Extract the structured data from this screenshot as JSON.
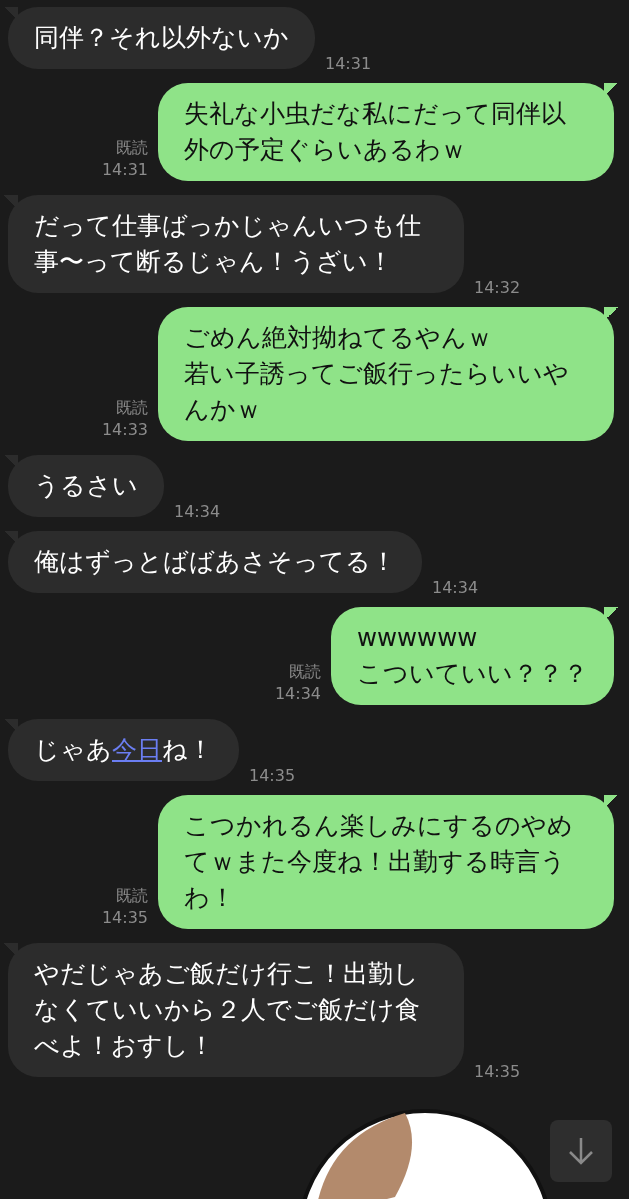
{
  "messages": [
    {
      "kind": "incoming",
      "lines": [
        "同伴？それ以外ないか"
      ],
      "time": "14:31"
    },
    {
      "kind": "outgoing",
      "lines": [
        "失礼な小虫だな私にだって同伴以外の予定ぐらいあるわｗ"
      ],
      "read": "既読",
      "time": "14:31"
    },
    {
      "kind": "incoming",
      "lines": [
        "だって仕事ばっかじゃんいつも仕事〜って断るじゃん！うざい！"
      ],
      "time": "14:32"
    },
    {
      "kind": "outgoing",
      "lines": [
        "ごめん絶対拗ねてるやんｗ",
        "若い子誘ってご飯行ったらいいやんかｗ"
      ],
      "read": "既読",
      "time": "14:33"
    },
    {
      "kind": "incoming",
      "lines": [
        "うるさい"
      ],
      "time": "14:34"
    },
    {
      "kind": "incoming",
      "lines": [
        "俺はずっとばばあさそってる！"
      ],
      "time": "14:34"
    },
    {
      "kind": "outgoing",
      "lines": [
        "wwwwww",
        "こついていい？？？"
      ],
      "read": "既読",
      "time": "14:34"
    },
    {
      "kind": "incoming",
      "parts": [
        {
          "kind": "text",
          "text": "じゃあ"
        },
        {
          "kind": "link",
          "text": "今日"
        },
        {
          "kind": "text",
          "text": "ね！"
        }
      ],
      "time": "14:35"
    },
    {
      "kind": "outgoing",
      "lines": [
        "こつかれるん楽しみにするのやめてｗまた今度ね！出勤する時言うわ！"
      ],
      "read": "既読",
      "time": "14:35"
    },
    {
      "kind": "incoming",
      "lines": [
        "やだじゃあご飯だけ行こ！出勤しなくていいから２人でご飯だけ食べよ！おすし！"
      ],
      "time": "14:35"
    },
    {
      "kind": "picture"
    }
  ]
}
